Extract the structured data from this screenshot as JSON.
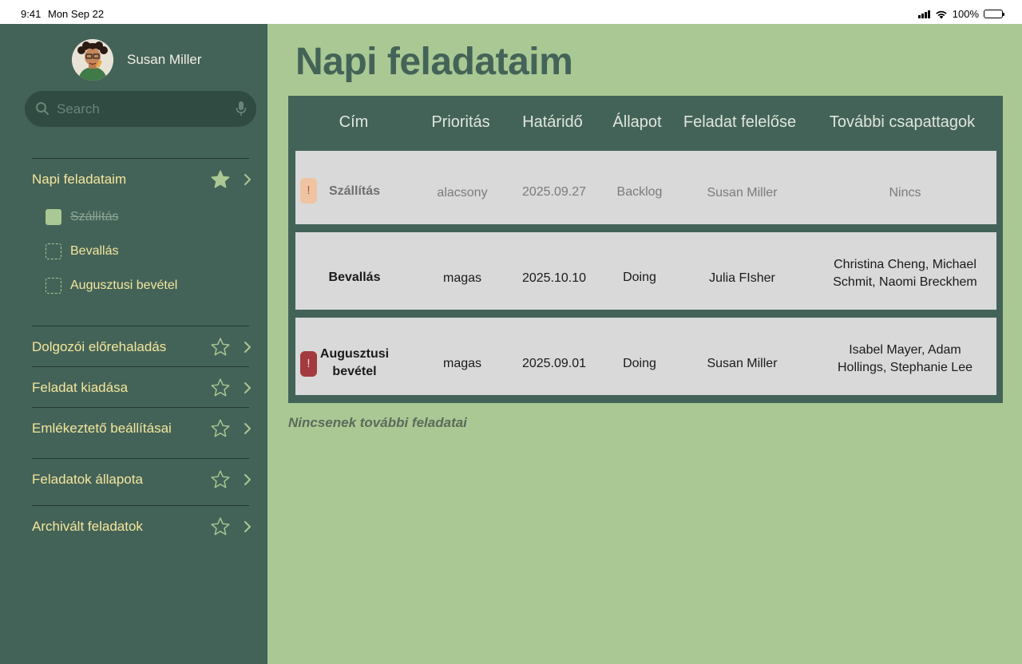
{
  "status_bar": {
    "time": "9:41",
    "date": "Mon Sep 22",
    "battery": "100%",
    "icons": [
      "signal-icon",
      "wifi-icon",
      "battery-icon"
    ]
  },
  "sidebar": {
    "user_name": "Susan Miller",
    "search_placeholder": "Search",
    "nav_items": [
      {
        "label": "Napi feladataim",
        "starred": true
      },
      {
        "label": "Dolgozói előrehaladás",
        "starred": false
      },
      {
        "label": "Feladat kiadása",
        "starred": false
      },
      {
        "label": "Emlékeztető beállításai",
        "starred": false
      },
      {
        "label": "Feladatok állapota",
        "starred": false
      },
      {
        "label": "Archivált feladatok",
        "starred": false
      }
    ],
    "sub_items": [
      {
        "label": "Szállítás",
        "done": true
      },
      {
        "label": "Bevallás",
        "done": false
      },
      {
        "label": "Augusztusi bevétel",
        "done": false
      }
    ]
  },
  "main": {
    "title": "Napi feladataim",
    "columns": [
      "Cím",
      "Prioritás",
      "Határidő",
      "Állapot",
      "Feladat felelőse",
      "További csapattagok"
    ],
    "rows": [
      {
        "flag": "!",
        "title": "Szállítás",
        "priority": "alacsony",
        "deadline": "2025.09.27",
        "status": "Backlog",
        "owner": "Susan Miller",
        "team": "Nincs"
      },
      {
        "flag": "",
        "title": "Bevallás",
        "priority": "magas",
        "deadline": "2025.10.10",
        "status": "Doing",
        "owner": "Julia FIsher",
        "team_line1": "Christina Cheng, Michael",
        "team_line2": "Schmit, Naomi Breckhem"
      },
      {
        "flag": "!",
        "title_line1": "Augusztusi",
        "title_line2": "bevétel",
        "priority": "magas",
        "deadline": "2025.09.01",
        "status": "Doing",
        "owner": "Susan Miller",
        "team_line1": "Isabel Mayer, Adam",
        "team_line2": "Hollings, Stephanie Lee"
      }
    ],
    "footer_note": "Nincsenek további feladatai"
  },
  "colors": {
    "sidebar_bg": "#446358",
    "main_bg": "#aac893",
    "nav_text": "#f4e79c",
    "flag_low": "#f0c3a2",
    "flag_high": "#a33a3f"
  }
}
